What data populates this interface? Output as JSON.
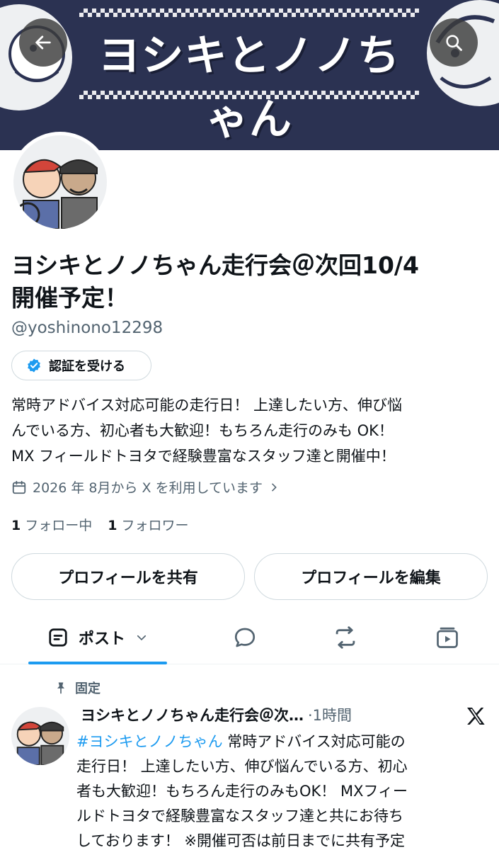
{
  "banner": {
    "title": "ヨシキとノノちゃん"
  },
  "profile": {
    "display_name_line1": "ヨシキとノノちゃん走行会＠次回10/4",
    "display_name_line2": "開催予定！",
    "handle": "@yoshinono12298",
    "verify_label": "認証を受ける",
    "bio_lines": [
      "常時アドバイス対応可能の走行日！ 上達したい方、伸び悩",
      "んでいる方、初心者も大歓迎！もちろん走行のみも OK！",
      " MX フィールドトヨタで経験豊富なスタッフ達と開催中！"
    ],
    "joined": "2026 年 8月から X を利用しています",
    "following_count": "1",
    "following_label": "フォロー中",
    "followers_count": "1",
    "followers_label": "フォロワー"
  },
  "actions": {
    "share_label": "プロフィールを共有",
    "edit_label": "プロフィールを編集"
  },
  "tabs": {
    "posts_label": "ポスト"
  },
  "pinned_post": {
    "pinned_label": "固定",
    "author": "ヨシキとノノちゃん走行会＠次…",
    "time": "·1時間",
    "hashtag": "#ヨシキとノノちゃん",
    "line1_rest": " 常時アドバイス対応可能の",
    "lines": [
      "走行日！ 上達したい方、伸び悩んでいる方、初心",
      "者も大歓迎！もちろん走行のみもOK！ MXフィー",
      "ルドトヨタで経験豊富なスタッフ達と共にお待ち",
      "しております！ ※開催可否は前日までに共有予定"
    ]
  },
  "colors": {
    "accent": "#1d9bf0",
    "banner_bg": "#2b3252",
    "secondary_text": "#536471",
    "border": "#cfd9de"
  },
  "icons": [
    "back-arrow-icon",
    "search-icon",
    "verified-badge-icon",
    "calendar-icon",
    "chevron-right-icon",
    "posts-tab-icon",
    "chevron-down-icon",
    "reply-bubble-icon",
    "repost-icon",
    "media-play-icon",
    "pin-icon",
    "x-logo-icon"
  ]
}
